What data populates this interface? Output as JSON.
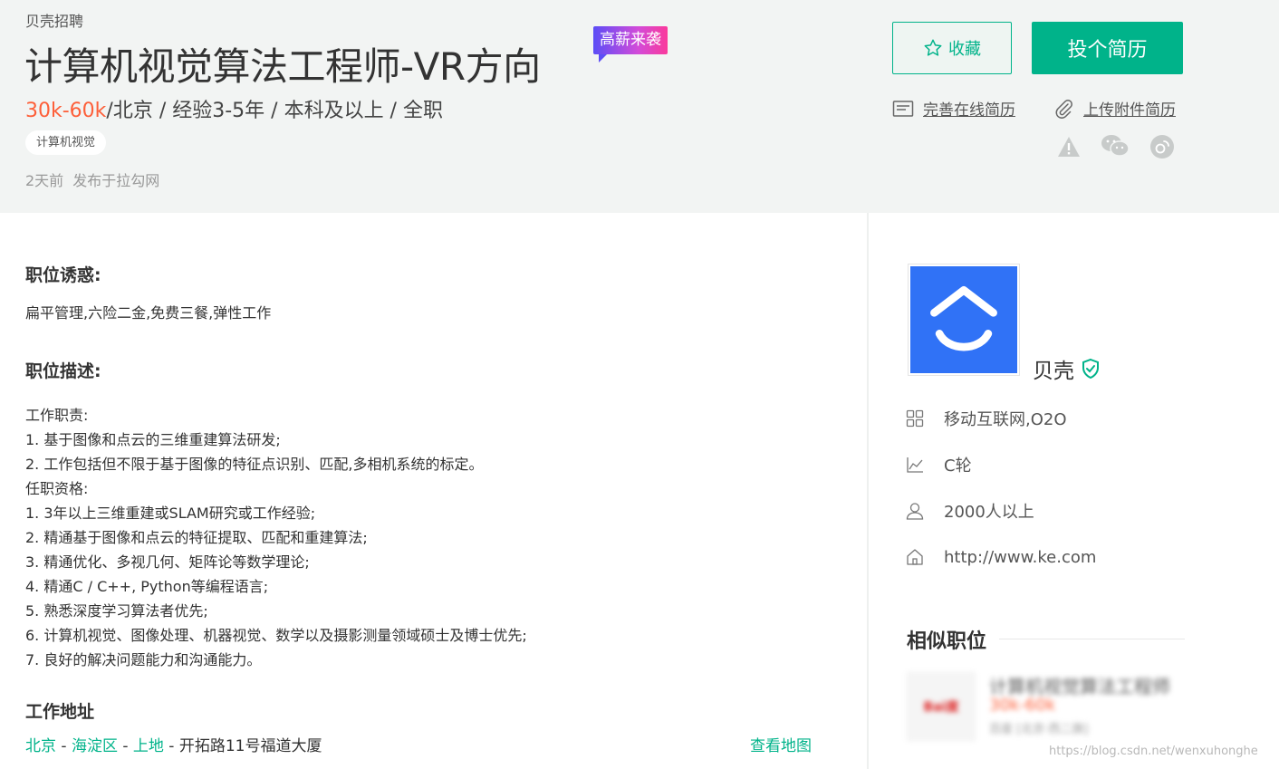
{
  "header": {
    "company_small": "贝壳招聘",
    "job_title": "计算机视觉算法工程师-VR方向",
    "hot_badge": "高薪来袭",
    "salary": "30k-60k",
    "meta": "/北京 / 经验3-5年 / 本科及以上 / 全职",
    "tag": "计算机视觉",
    "posted_time": "2天前",
    "posted_source": "发布于拉勾网"
  },
  "actions": {
    "collect_label": "收藏",
    "apply_label": "投个简历",
    "online_resume": "完善在线简历",
    "attach_resume": "上传附件简历"
  },
  "share_icons": [
    "warning-icon",
    "wechat-icon",
    "weibo-icon"
  ],
  "content": {
    "perks_title": "职位诱惑:",
    "perks_text": "扁平管理,六险二金,免费三餐,弹性工作",
    "desc_title": "职位描述:",
    "desc_lines": [
      "工作职责:",
      "1. 基于图像和点云的三维重建算法研发;",
      "2. 工作包括但不限于基于图像的特征点识别、匹配,多相机系统的标定。",
      "任职资格:",
      "1. 3年以上三维重建或SLAM研究或工作经验;",
      "2. 精通基于图像和点云的特征提取、匹配和重建算法;",
      "3. 精通优化、多视几何、矩阵论等数学理论;",
      "4. 精通C / C++, Python等编程语言;",
      "5. 熟悉深度学习算法者优先;",
      "6. 计算机视觉、图像处理、机器视觉、数学以及摄影测量领域硕士及博士优先;",
      "7. 良好的解决问题能力和沟通能力。"
    ],
    "address_title": "工作地址",
    "address_city": "北京",
    "address_district": "海淀区",
    "address_area": "上地",
    "address_street": "开拓路11号福道大厦",
    "address_sep": " - ",
    "view_map": "查看地图"
  },
  "company": {
    "name": "贝壳",
    "industry": "移动互联网,O2O",
    "stage": "C轮",
    "size": "2000人以上",
    "website": "http://www.ke.com"
  },
  "similar": {
    "title": "相似职位",
    "items": [
      {
        "title": "计算机视觉算法工程师",
        "salary": "30k-60k",
        "location": "百度 [北京·西二旗]",
        "logo_text": "Bai度"
      }
    ]
  },
  "watermark": "https://blog.csdn.net/wenxuhonghe",
  "colors": {
    "accent": "#00b38a",
    "salary": "#fd5f39",
    "logo_bg": "#3072f6"
  }
}
